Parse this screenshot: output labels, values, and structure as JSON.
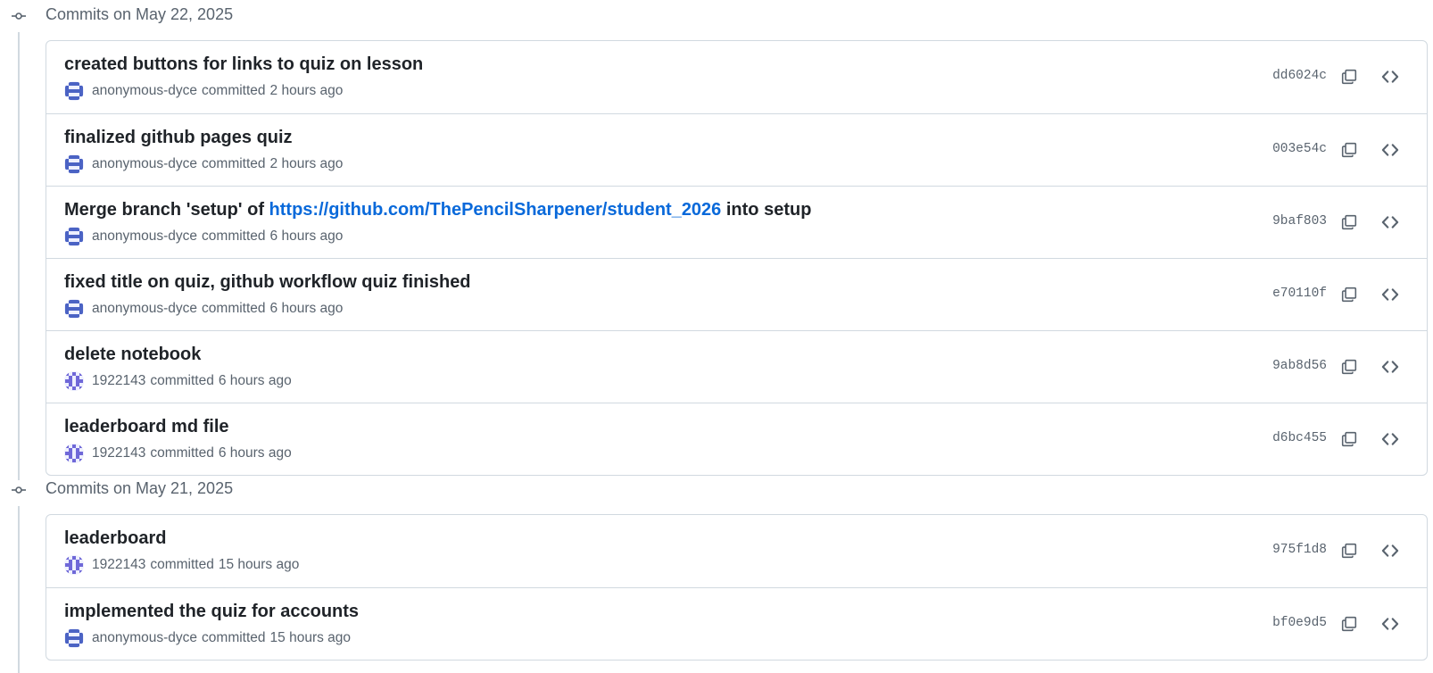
{
  "colors": {
    "border": "#d1d9e0",
    "muted_text": "#59636e",
    "primary_text": "#1f2328",
    "link": "#0969da",
    "avatar_pixel_blue": "#4b63c4",
    "avatar_pixel_purple": "#6f68d8"
  },
  "groups": [
    {
      "title": "Commits on May 22, 2025",
      "commits": [
        {
          "title_before": "created buttons for links to quiz on lesson",
          "title_link": "",
          "title_after": "",
          "author": "anonymous-dyce",
          "action": "committed",
          "time": "2 hours ago",
          "sha": "dd6024c",
          "avatar_icon": "identicon-anonymous-dyce"
        },
        {
          "title_before": "finalized github pages quiz",
          "title_link": "",
          "title_after": "",
          "author": "anonymous-dyce",
          "action": "committed",
          "time": "2 hours ago",
          "sha": "003e54c",
          "avatar_icon": "identicon-anonymous-dyce"
        },
        {
          "title_before": "Merge branch 'setup' of ",
          "title_link": "https://github.com/ThePencilSharpener/student_2026",
          "title_after": " into setup",
          "author": "anonymous-dyce",
          "action": "committed",
          "time": "6 hours ago",
          "sha": "9baf803",
          "avatar_icon": "identicon-anonymous-dyce"
        },
        {
          "title_before": "fixed title on quiz, github workflow quiz finished",
          "title_link": "",
          "title_after": "",
          "author": "anonymous-dyce",
          "action": "committed",
          "time": "6 hours ago",
          "sha": "e70110f",
          "avatar_icon": "identicon-anonymous-dyce"
        },
        {
          "title_before": "delete notebook",
          "title_link": "",
          "title_after": "",
          "author": "1922143",
          "action": "committed",
          "time": "6 hours ago",
          "sha": "9ab8d56",
          "avatar_icon": "identicon-1922143"
        },
        {
          "title_before": "leaderboard md file",
          "title_link": "",
          "title_after": "",
          "author": "1922143",
          "action": "committed",
          "time": "6 hours ago",
          "sha": "d6bc455",
          "avatar_icon": "identicon-1922143"
        }
      ]
    },
    {
      "title": "Commits on May 21, 2025",
      "commits": [
        {
          "title_before": "leaderboard",
          "title_link": "",
          "title_after": "",
          "author": "1922143",
          "action": "committed",
          "time": "15 hours ago",
          "sha": "975f1d8",
          "avatar_icon": "identicon-1922143"
        },
        {
          "title_before": "implemented the quiz for accounts",
          "title_link": "",
          "title_after": "",
          "author": "anonymous-dyce",
          "action": "committed",
          "time": "15 hours ago",
          "sha": "bf0e9d5",
          "avatar_icon": "identicon-anonymous-dyce"
        }
      ]
    }
  ],
  "icons": {
    "group_node": "git-commit-icon",
    "copy": "copy-icon",
    "browse": "code-icon"
  }
}
